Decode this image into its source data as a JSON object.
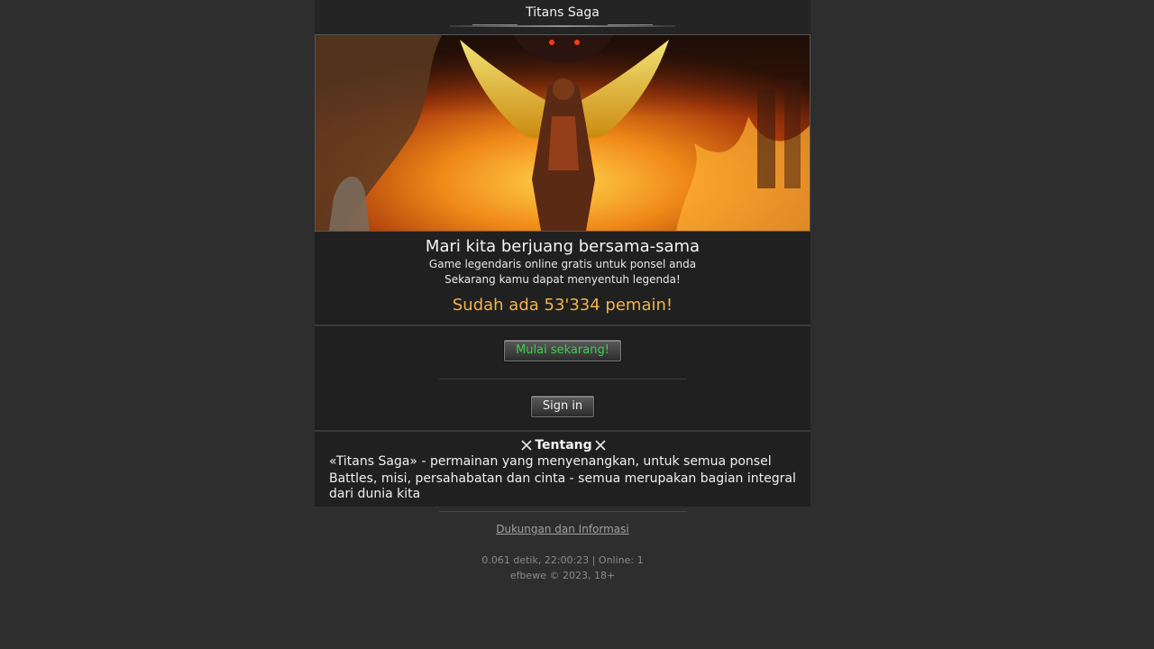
{
  "header": {
    "title": "Titans Saga"
  },
  "banner": {
    "alt": "Titans Saga armored warrior with golden wings amid flames"
  },
  "intro": {
    "headline": "Mari kita berjuang bersama-sama",
    "line1": "Game legendaris online gratis untuk ponsel anda",
    "line2": "Sekarang kamu dapat menyentuh legenda!",
    "players": "Sudah ada 53'334 pemain!"
  },
  "actions": {
    "start_label": "Mulai sekarang!",
    "signin_label": "Sign in"
  },
  "about": {
    "title": "Tentang",
    "line1": "«Titans Saga» - permainan yang menyenangkan, untuk semua ponsel",
    "line2": "Battles, misi, persahabatan dan cinta - semua merupakan bagian integral dari dunia kita"
  },
  "footer": {
    "support_link": "Dukungan dan Informasi",
    "stats": "0.061 detik, 22:00:23 | Online: 1",
    "copyright": "efbewe © 2023, 18+"
  },
  "colors": {
    "background": "#2e2e2e",
    "panel": "#202020",
    "players_accent": "#f3b34a",
    "start_button_text": "#39d14a"
  },
  "icons": {
    "about_title_decoration": "crossed-swords-icon"
  }
}
